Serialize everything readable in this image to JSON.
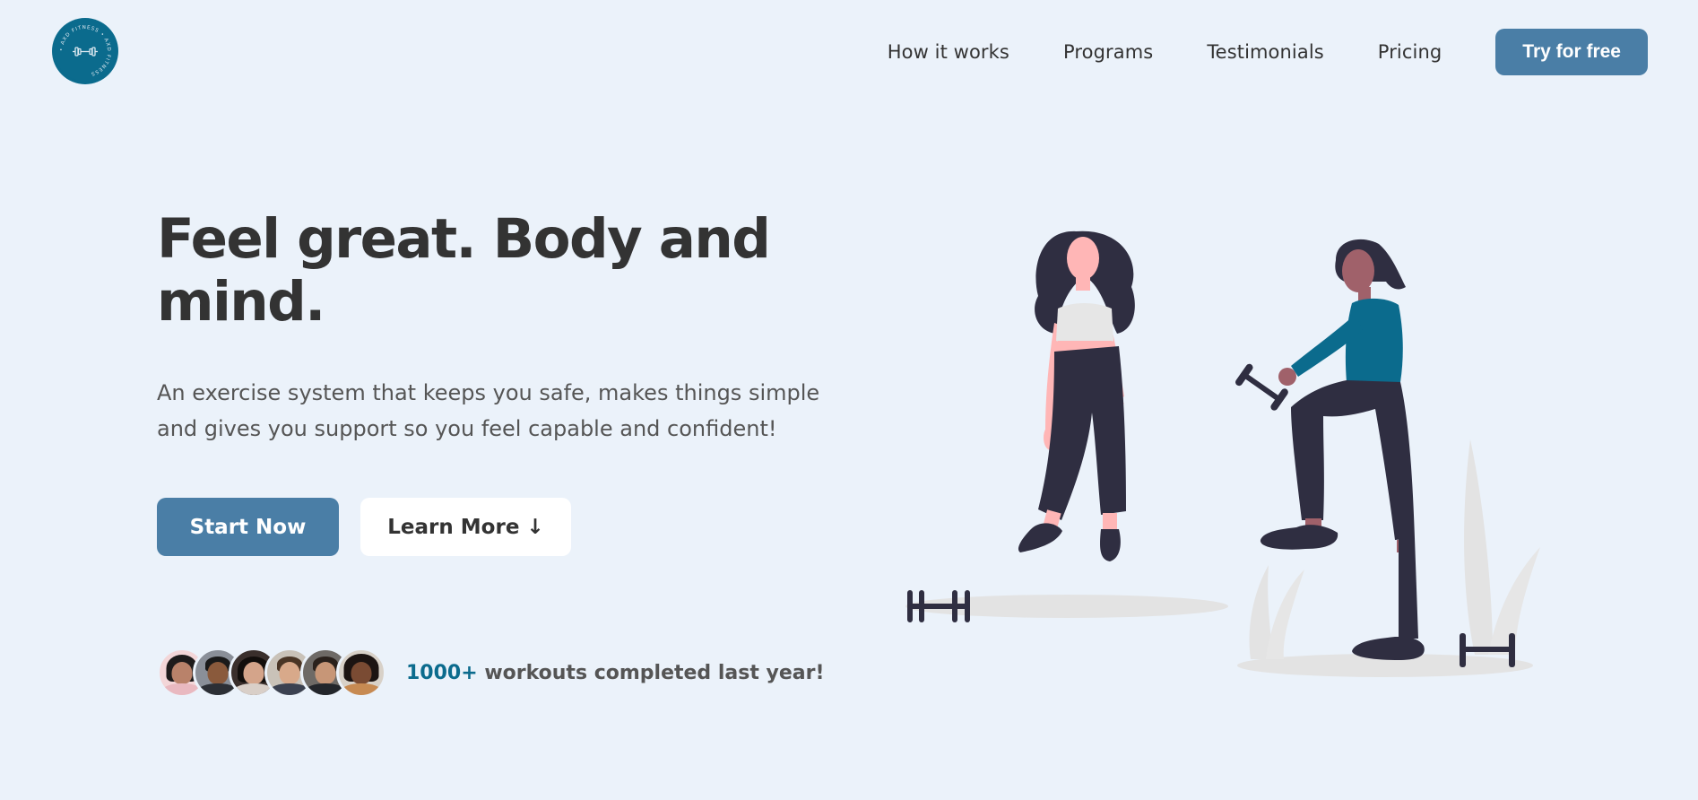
{
  "header": {
    "logo": {
      "ring_text": "• AXD FITNESS • AXD FITNESS",
      "icon": "dumbbell-icon",
      "color": "#0b6b8d"
    },
    "nav": {
      "links": [
        "How it works",
        "Programs",
        "Testimonials",
        "Pricing"
      ],
      "cta_label": "Try for free"
    }
  },
  "hero": {
    "title": "Feel great. Body and mind.",
    "description": "An exercise system that keeps you safe, makes things simple and gives you support so you feel capable and confident!",
    "primary_button": "Start Now",
    "secondary_button": "Learn More ↓",
    "social_proof": {
      "count": "1000+",
      "text": " workouts completed last year!",
      "avatar_count": 6
    }
  },
  "illustration": {
    "description_icon": "two-women-exercising-illustration",
    "accent_color": "#0b6b8d"
  },
  "colors": {
    "background": "#ebf2fa",
    "primary": "#4a7ea6",
    "accent": "#0b6b8d",
    "text": "#333333"
  }
}
